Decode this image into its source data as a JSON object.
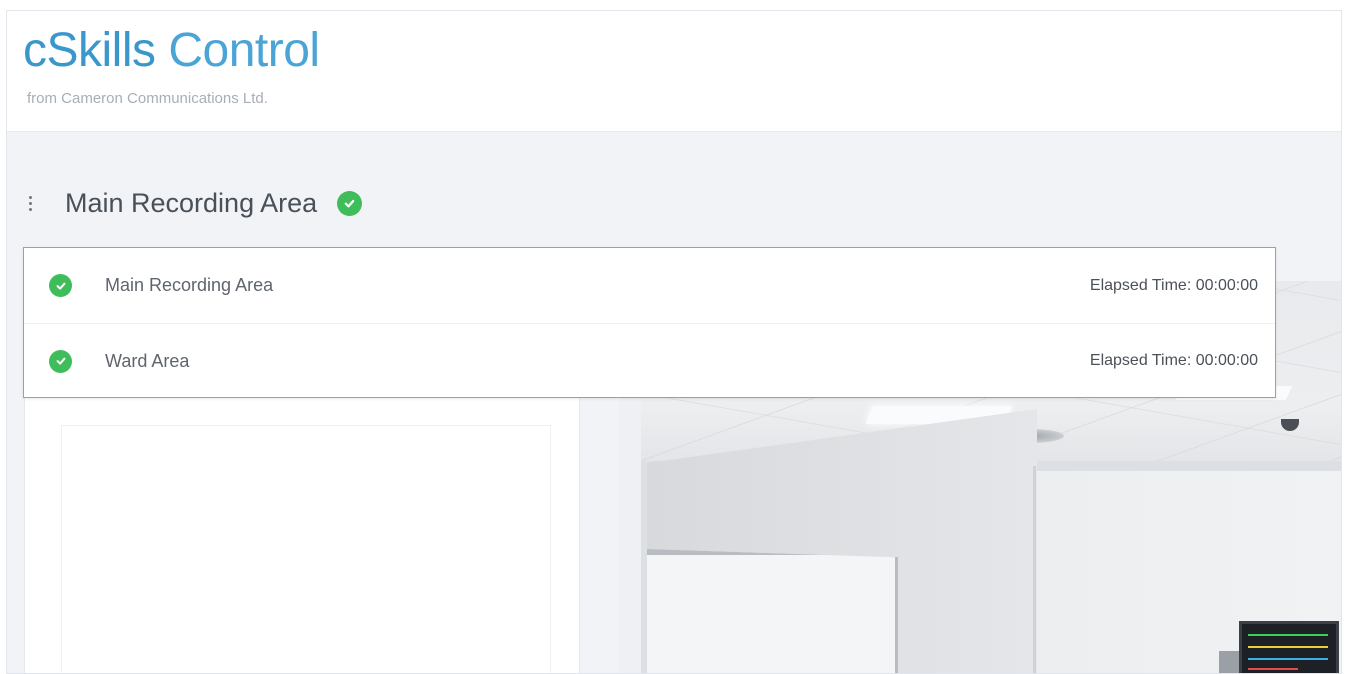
{
  "brand": {
    "title_main": "cSkills",
    "title_light": "Control",
    "subtitle": "from Cameron Communications Ltd."
  },
  "section": {
    "menu_icon": "vertical-ellipsis-icon",
    "title": "Main Recording Area",
    "status_icon": "check-circle-icon",
    "status_color": "#3ebd5a"
  },
  "areas": [
    {
      "label": "Main Recording Area",
      "status_icon": "check-circle-icon",
      "elapsed": "Elapsed Time: 00:00:00"
    },
    {
      "label": "Ward Area",
      "status_icon": "check-circle-icon",
      "elapsed": "Elapsed Time: 00:00:00"
    }
  ],
  "colors": {
    "brand": "#3a97cc",
    "success": "#3ebd5a",
    "page_bg": "#f1f3f7"
  }
}
